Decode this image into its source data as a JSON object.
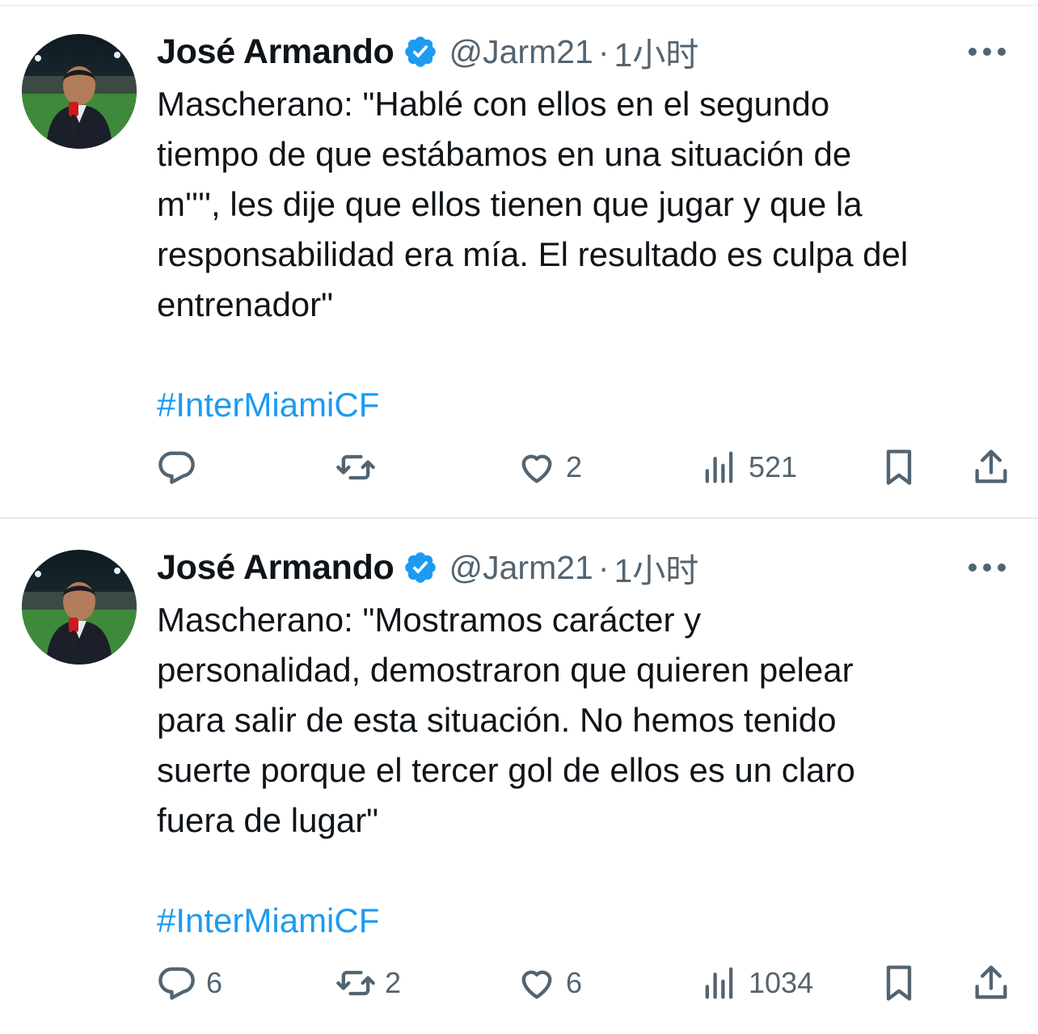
{
  "colors": {
    "text": "#0f1419",
    "secondary": "#536471",
    "accent": "#1d9bf0",
    "divider": "#e6e9eb"
  },
  "icons": {
    "verified": "verified-badge-icon",
    "reply": "reply-icon",
    "retweet": "retweet-icon",
    "like": "heart-icon",
    "views": "bar-chart-icon",
    "bookmark": "bookmark-icon",
    "share": "share-icon",
    "more": "more-horizontal-icon"
  },
  "tweets": [
    {
      "author": {
        "name": "José Armando",
        "handle": "@Jarm21",
        "separator": "·",
        "time": "1小时"
      },
      "text": "Mascherano: \"Hablé con ellos en el segundo\ntiempo de que estábamos en una situación de\nm'''', les dije que ellos tienen que jugar y que la\nresponsabilidad era mía. El resultado es culpa del\nentrenador\"",
      "hashtag": "#InterMiamiCF",
      "stats": {
        "replies": "",
        "retweets": "",
        "likes": "2",
        "views": "521"
      }
    },
    {
      "author": {
        "name": "José Armando",
        "handle": "@Jarm21",
        "separator": "·",
        "time": "1小时"
      },
      "text": "Mascherano: \"Mostramos carácter y\npersonalidad, demostraron que quieren pelear\npara salir de esta situación. No hemos tenido\nsuerte porque el tercer gol de ellos es un claro\nfuera de lugar\"",
      "hashtag": "#InterMiamiCF",
      "stats": {
        "replies": "6",
        "retweets": "2",
        "likes": "6",
        "views": "1034"
      }
    }
  ]
}
